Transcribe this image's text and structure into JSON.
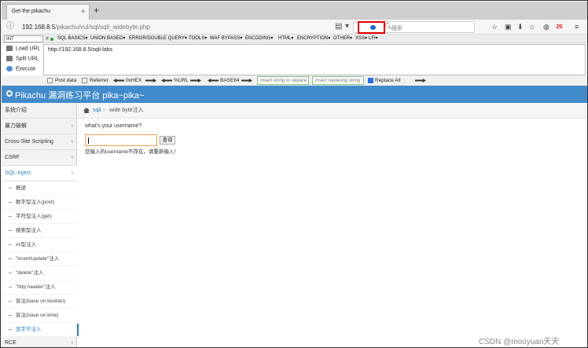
{
  "browser": {
    "tab_title": "Get the pikachu",
    "tab_close": "×",
    "new_tab": "+",
    "url_host": "192.168.8.5",
    "url_path": "/pikachu/vul/sql/sqli_widebyte.php",
    "search_placeholder": "搜索",
    "right_icons": [
      "☆",
      "▣",
      "⬇",
      "⌂",
      "◍",
      "JS",
      "≡"
    ]
  },
  "hackbar": {
    "select_value": "INT",
    "menus": [
      "SQL BASICS▾",
      "UNION BASED▾",
      "ERROR/DOUBLE QUERY▾",
      "TOOLS▾",
      "WAF BYPASS▾",
      "ENCODING▾",
      "HTML▾",
      "ENCRYPTION▾",
      "OTHER▾",
      "XSS▾",
      "LFI▾"
    ],
    "side_buttons": [
      "Load URL",
      "Split URL",
      "Execute"
    ],
    "url_value": "http://192.168.8.5/sqli-labs",
    "options": {
      "post_data": "Post data",
      "referrer": "Referrer",
      "hex": "0xHEX",
      "url_enc": "%URL",
      "base64": "BASE64",
      "replace_placeholder": "Insert string to replace",
      "replacing_placeholder": "Insert replacing string",
      "replace_all": "Replace All"
    }
  },
  "app": {
    "title": "Pikachu 漏洞练习平台 pika~pika~"
  },
  "sidebar": {
    "items": [
      {
        "label": "系统介绍",
        "chev": ""
      },
      {
        "label": "暴力破解",
        "chev": "›"
      },
      {
        "label": "Cross-Site Scripting",
        "chev": "›"
      },
      {
        "label": "CSRF",
        "chev": "›"
      },
      {
        "label": "SQL-Inject",
        "chev": "›"
      }
    ],
    "sub_items": [
      "概述",
      "数字型注入(post)",
      "字符型注入(get)",
      "搜索型注入",
      "xx型注入",
      "\"insert/update\"注入",
      "\"delete\"注入",
      "\"http header\"注入",
      "盲注(base on boolian)",
      "盲注(base on time)",
      "宽字节注入"
    ],
    "next_item": "RCE"
  },
  "breadcrumb": {
    "section": "sqli",
    "page": "wide byte注入"
  },
  "main": {
    "question": "what's your username?",
    "query_button": "查询",
    "result": "您输入的username不存在，请重新输入！"
  },
  "watermark": "CSDN @mooyuan天天"
}
